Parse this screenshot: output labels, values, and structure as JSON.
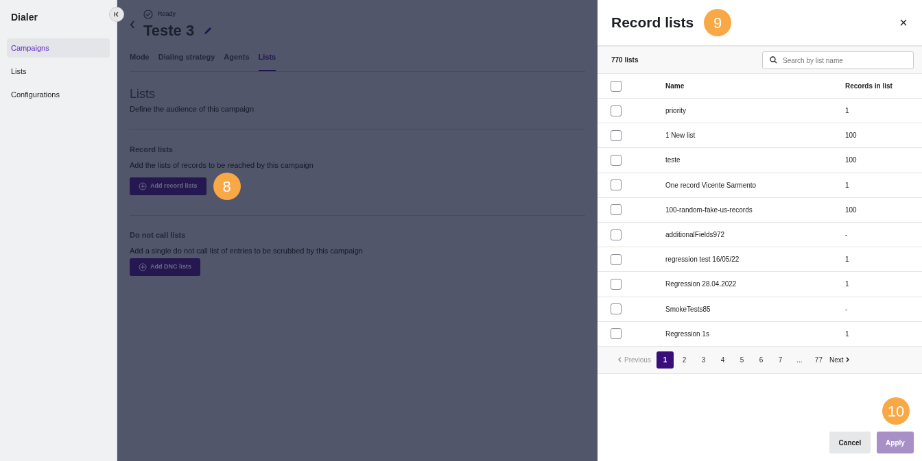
{
  "sidebar": {
    "title": "Dialer",
    "items": [
      {
        "label": "Campaigns",
        "selected": true
      },
      {
        "label": "Lists",
        "selected": false
      },
      {
        "label": "Configurations",
        "selected": false
      }
    ]
  },
  "header": {
    "status": "Ready",
    "title": "Teste 3"
  },
  "tabs": [
    {
      "label": "Mode",
      "selected": false
    },
    {
      "label": "Dialing strategy",
      "selected": false
    },
    {
      "label": "Agents",
      "selected": false
    },
    {
      "label": "Lists",
      "selected": true
    }
  ],
  "page": {
    "title": "Lists",
    "subtitle": "Define the audience of this campaign"
  },
  "sections": [
    {
      "title": "Record lists",
      "description": "Add the lists of records to be reached by this campaign",
      "button": "Add record lists",
      "callout": "8"
    },
    {
      "title": "Do not call lists",
      "description": "Add a single do not call list of entries to be scrubbed by this campaign",
      "button": "Add DNC lists"
    }
  ],
  "drawer": {
    "title": "Record lists",
    "callout": "9",
    "count": "770 lists",
    "search": {
      "placeholder": "Search by list name"
    },
    "select_all": {
      "checked": false
    },
    "columns": [
      "Name",
      "Records in list"
    ],
    "rows": [
      {
        "name": "priority",
        "records": "1",
        "checked": false
      },
      {
        "name": "1 New list",
        "records": "100",
        "checked": false
      },
      {
        "name": "teste",
        "records": "100",
        "checked": false
      },
      {
        "name": "One record Vicente Sarmento",
        "records": "1",
        "checked": false
      },
      {
        "name": "100-random-fake-us-records",
        "records": "100",
        "checked": false
      },
      {
        "name": "additionalFields972",
        "records": "-",
        "checked": false
      },
      {
        "name": "regression test 16/05/22",
        "records": "1",
        "checked": false
      },
      {
        "name": "Regression 28.04.2022",
        "records": "1",
        "checked": false
      },
      {
        "name": "SmokeTests85",
        "records": "-",
        "checked": false
      },
      {
        "name": "Regression 1s",
        "records": "1",
        "checked": false
      }
    ],
    "pagination": {
      "previous": {
        "label": "Previous",
        "disabled": true
      },
      "pages": [
        {
          "label": "1",
          "selected": true
        },
        {
          "label": "2",
          "selected": false
        },
        {
          "label": "3",
          "selected": false
        },
        {
          "label": "4",
          "selected": false
        },
        {
          "label": "5",
          "selected": false
        },
        {
          "label": "6",
          "selected": false
        },
        {
          "label": "7",
          "selected": false
        },
        {
          "label": "...",
          "selected": false
        },
        {
          "label": "77",
          "selected": false
        }
      ],
      "next": {
        "label": "Next",
        "disabled": false
      }
    },
    "footer_callout": "10",
    "cancel": {
      "label": "Cancel"
    },
    "apply": {
      "label": "Apply",
      "disabled": true
    }
  }
}
